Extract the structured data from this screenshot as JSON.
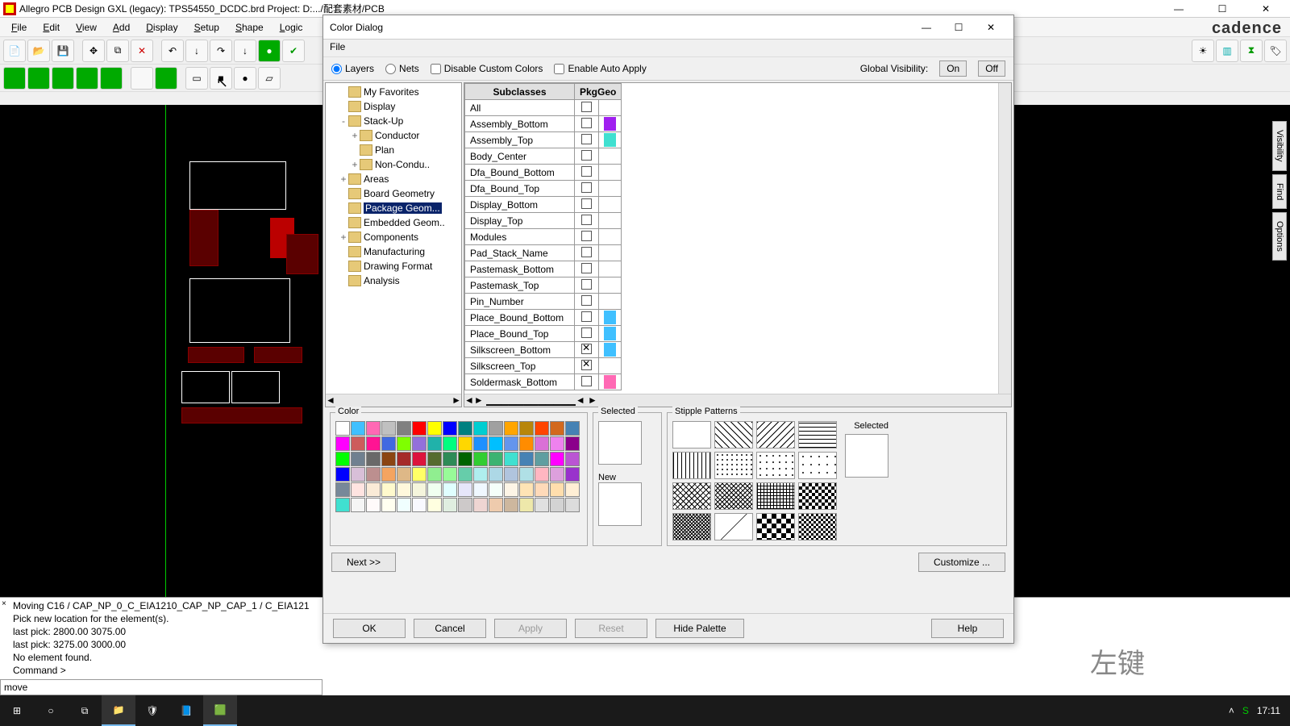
{
  "window": {
    "title": "Allegro PCB Design GXL (legacy): TPS54550_DCDC.brd  Project: D:.../配套素材/PCB"
  },
  "menus": [
    "File",
    "Edit",
    "View",
    "Add",
    "Display",
    "Setup",
    "Shape",
    "Logic"
  ],
  "brand": "cadence",
  "dialog": {
    "title": "Color Dialog",
    "file_menu": "File",
    "mode_layers": "Layers",
    "mode_nets": "Nets",
    "disable_colors": "Disable Custom Colors",
    "enable_auto": "Enable Auto Apply",
    "global_vis": "Global Visibility:",
    "on": "On",
    "off": "Off",
    "tree": [
      {
        "label": "My Favorites",
        "indent": 1
      },
      {
        "label": "Display",
        "indent": 1
      },
      {
        "label": "Stack-Up",
        "indent": 1,
        "exp": "-"
      },
      {
        "label": "Conductor",
        "indent": 2,
        "exp": "+"
      },
      {
        "label": "Plan",
        "indent": 2
      },
      {
        "label": "Non-Condu..",
        "indent": 2,
        "exp": "+"
      },
      {
        "label": "Areas",
        "indent": 1,
        "exp": "+"
      },
      {
        "label": "Board Geometry",
        "indent": 1
      },
      {
        "label": "Package Geom...",
        "indent": 1,
        "sel": true
      },
      {
        "label": "Embedded Geom..",
        "indent": 1
      },
      {
        "label": "Components",
        "indent": 1,
        "exp": "+"
      },
      {
        "label": "Manufacturing",
        "indent": 1
      },
      {
        "label": "Drawing Format",
        "indent": 1
      },
      {
        "label": "Analysis",
        "indent": 1
      }
    ],
    "table_hdr": {
      "c1": "Subclasses",
      "c2": "PkgGeo"
    },
    "rows": [
      {
        "name": "All",
        "on": false,
        "color": ""
      },
      {
        "name": "Assembly_Bottom",
        "on": false,
        "color": "#a020f0"
      },
      {
        "name": "Assembly_Top",
        "on": false,
        "color": "#40e0d0"
      },
      {
        "name": "Body_Center",
        "on": false,
        "color": ""
      },
      {
        "name": "Dfa_Bound_Bottom",
        "on": false,
        "color": ""
      },
      {
        "name": "Dfa_Bound_Top",
        "on": false,
        "color": ""
      },
      {
        "name": "Display_Bottom",
        "on": false,
        "color": ""
      },
      {
        "name": "Display_Top",
        "on": false,
        "color": ""
      },
      {
        "name": "Modules",
        "on": false,
        "color": ""
      },
      {
        "name": "Pad_Stack_Name",
        "on": false,
        "color": ""
      },
      {
        "name": "Pastemask_Bottom",
        "on": false,
        "color": ""
      },
      {
        "name": "Pastemask_Top",
        "on": false,
        "color": ""
      },
      {
        "name": "Pin_Number",
        "on": false,
        "color": ""
      },
      {
        "name": "Place_Bound_Bottom",
        "on": false,
        "color": "#40c0ff"
      },
      {
        "name": "Place_Bound_Top",
        "on": false,
        "color": "#40c0ff"
      },
      {
        "name": "Silkscreen_Bottom",
        "on": true,
        "color": "#40c0ff"
      },
      {
        "name": "Silkscreen_Top",
        "on": true,
        "color": ""
      },
      {
        "name": "Soldermask_Bottom",
        "on": false,
        "color": "#ff69b4"
      }
    ],
    "color_label": "Color",
    "selected_label": "Selected",
    "new_label": "New",
    "stipple_label": "Stipple Patterns",
    "next": "Next >>",
    "customize": "Customize ...",
    "ok": "OK",
    "cancel": "Cancel",
    "apply": "Apply",
    "reset": "Reset",
    "hide": "Hide Palette",
    "help": "Help"
  },
  "palette_colors": [
    "#ffffff",
    "#40c0ff",
    "#ff69b4",
    "#c0c0c0",
    "#808080",
    "#ff0000",
    "#ffff00",
    "#0000ff",
    "#008080",
    "#00ced1",
    "#a0a0a0",
    "#ffa500",
    "#b8860b",
    "#ff4500",
    "#d2691e",
    "#4682b4",
    "#ff00ff",
    "#cd5c5c",
    "#ff1493",
    "#4169e1",
    "#7fff00",
    "#9370db",
    "#20b2aa",
    "#00ff7f",
    "#ffd700",
    "#1e90ff",
    "#00bfff",
    "#6495ed",
    "#ff8c00",
    "#da70d6",
    "#ee82ee",
    "#8b008b",
    "#00ff00",
    "#708090",
    "#696969",
    "#8b4513",
    "#a52a2a",
    "#dc143c",
    "#556b2f",
    "#2e8b57",
    "#006400",
    "#32cd32",
    "#3cb371",
    "#40e0d0",
    "#4682b4",
    "#5f9ea0",
    "#ff00ff",
    "#ba55d3",
    "#0000ff",
    "#d8bfd8",
    "#bc8f8f",
    "#f4a460",
    "#deb887",
    "#ffff66",
    "#90ee90",
    "#98fb98",
    "#66cdaa",
    "#afeeee",
    "#add8e6",
    "#b0c4de",
    "#b0e0e6",
    "#ffb6c1",
    "#dda0dd",
    "#9932cc",
    "#778899",
    "#ffe4e1",
    "#faebd7",
    "#fffacd",
    "#fff8dc",
    "#f5f5dc",
    "#f0fff0",
    "#e0ffff",
    "#e6e6fa",
    "#f0f8ff",
    "#f5fffa",
    "#fdf5e6",
    "#ffe4b5",
    "#ffdab9",
    "#ffdead",
    "#ffefd5",
    "#40e0d0",
    "#f5f5f5",
    "#fffafa",
    "#fffff0",
    "#f0ffff",
    "#f8f8ff",
    "#ffffe0",
    "#e0eee0",
    "#cdc9c9",
    "#eed5d2",
    "#eecbad",
    "#cdb79e",
    "#eee8aa",
    "#e0e0e0",
    "#d3d3d3",
    "#dcdcdc"
  ],
  "side_tabs": [
    "Visibility",
    "Find",
    "Options"
  ],
  "status": {
    "l1": "Moving C16 / CAP_NP_0_C_EIA1210_CAP_NP_CAP_1 / C_EIA121",
    "l2": "Pick new location for the element(s).",
    "l3": "last pick:  2800.00 3075.00",
    "l4": "last pick:  3275.00 3000.00",
    "l5": "No element found.",
    "l6": "Command >"
  },
  "cmd": "move",
  "clock": "17:11",
  "overlay": "左键"
}
